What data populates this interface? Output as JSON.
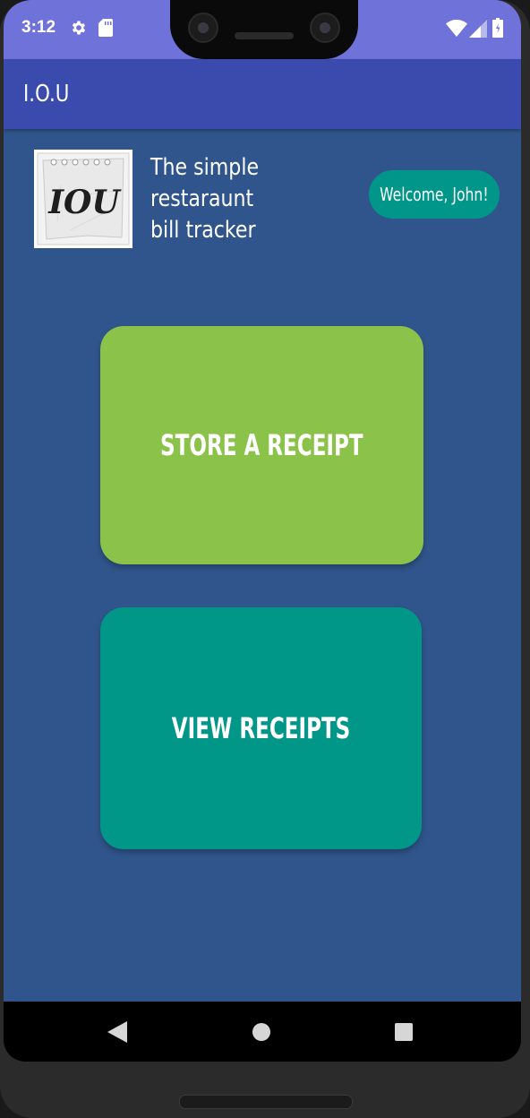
{
  "status_bar": {
    "time": "3:12",
    "icons": [
      "gear-icon",
      "sd-card-icon",
      "wifi-icon",
      "signal-icon",
      "battery-icon"
    ],
    "background": "#6f72d9"
  },
  "app_bar": {
    "title": "I.O.U",
    "background": "#3a4bad"
  },
  "header": {
    "logo_text": "IOU",
    "tagline_lines": [
      "The simple",
      "restaraunt",
      "bill tracker"
    ],
    "welcome": "Welcome, John!"
  },
  "actions": {
    "store_label": "STORE A RECEIPT",
    "view_label": "VIEW RECEIPTS"
  },
  "nav_bar": {
    "icons": [
      "back-icon",
      "home-icon",
      "recents-icon"
    ]
  },
  "colors": {
    "background": "#30558c",
    "store_button": "#8bc34a",
    "view_button": "#009688",
    "welcome_chip": "#00978a"
  }
}
